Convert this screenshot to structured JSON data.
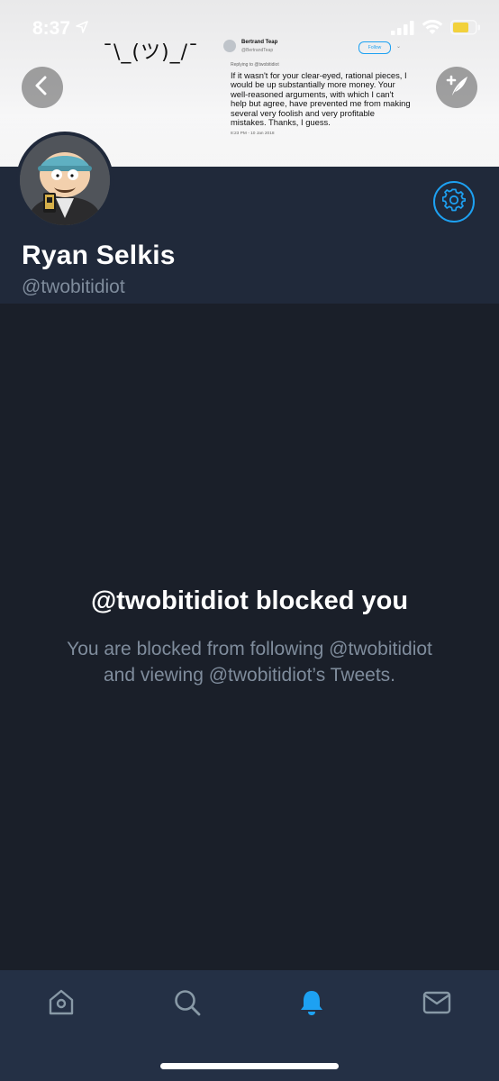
{
  "status_bar": {
    "time": "8:37",
    "battery_color": "#f2d13c"
  },
  "banner": {
    "shrug_text": "¯\\_(ツ)_/¯",
    "tweet": {
      "author_name": "Bertrand Teap",
      "author_handle": "@BertrandTeap",
      "follow_label": "Follow",
      "reply_context": "Replying to @twobitidiot",
      "body": "If it wasn't for your clear-eyed, rational pieces, I would be up substantially more money. Your well-reasoned arguments, with which I can't help but agree, have prevented me from making several very foolish and very profitable mistakes. Thanks, I guess.",
      "timestamp": "8:23 PM - 10 Jan 2018"
    }
  },
  "header_buttons": {
    "back_icon": "chevron-left-icon",
    "compose_icon": "compose-tweet-icon"
  },
  "profile": {
    "display_name": "Ryan Selkis",
    "handle": "@twobitidiot",
    "settings_icon": "gear-icon"
  },
  "blocked": {
    "title": "@twobitidiot blocked you",
    "description_line1": "You are blocked from following @twobitidiot",
    "description_line2": "and viewing @twobitidiot’s Tweets."
  },
  "tab_bar": {
    "items": [
      {
        "name": "home",
        "icon": "home-icon",
        "active": false
      },
      {
        "name": "search",
        "icon": "search-icon",
        "active": false
      },
      {
        "name": "notifications",
        "icon": "bell-icon",
        "active": true
      },
      {
        "name": "messages",
        "icon": "envelope-icon",
        "active": false
      }
    ]
  },
  "colors": {
    "background": "#1a1f29",
    "profile_background": "#20293a",
    "tab_bar": "#243045",
    "accent": "#1da1f2",
    "muted_text": "#7f8c9c"
  }
}
